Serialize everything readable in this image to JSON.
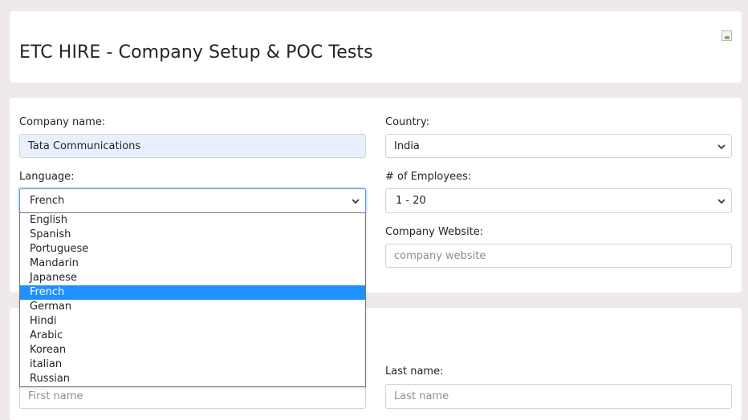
{
  "header": {
    "title": "ETC HIRE - Company Setup & POC Tests"
  },
  "company": {
    "name_label": "Company name:",
    "name_value": "Tata Communications",
    "country_label": "Country:",
    "country_value": "India",
    "language_label": "Language:",
    "language_value": "French",
    "employees_label": "# of Employees:",
    "employees_value": "1 - 20",
    "website_label": "Company Website:",
    "website_placeholder": "company website"
  },
  "language_options": [
    "English",
    "Spanish",
    "Portuguese",
    "Mandarin",
    "Japanese",
    "French",
    "German",
    "Hindi",
    "Arabic",
    "Korean",
    "italian",
    "Russian"
  ],
  "language_selected_index": 5,
  "poc": {
    "last_name_label": "Last name:",
    "first_name_placeholder": "First name",
    "last_name_placeholder": "Last name"
  },
  "colors": {
    "page_bg": "#efe9e9",
    "autofill_bg": "#e8f0fe",
    "option_highlight": "#1e90ff"
  },
  "icons": {
    "logo": "broken-image-icon",
    "select_arrow": "chevron-down-icon"
  }
}
